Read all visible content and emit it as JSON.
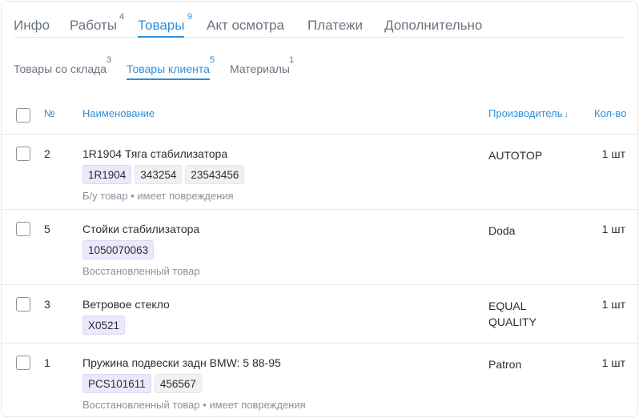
{
  "main_tabs": [
    {
      "label": "Инфо",
      "badge": ""
    },
    {
      "label": "Работы",
      "badge": "4"
    },
    {
      "label": "Товары",
      "badge": "9"
    },
    {
      "label": "Акт осмотра",
      "badge": ""
    },
    {
      "label": "Платежи",
      "badge": ""
    },
    {
      "label": "Дополнительно",
      "badge": ""
    }
  ],
  "sub_tabs": [
    {
      "label": "Товары со склада",
      "badge": "3"
    },
    {
      "label": "Товары клиента",
      "badge": "5"
    },
    {
      "label": "Материалы",
      "badge": "1"
    }
  ],
  "table": {
    "headers": {
      "num": "№",
      "name": "Наименование",
      "maker": "Производитель",
      "maker_sort_icon": "arrow-down-icon",
      "qty": "Кол-во"
    },
    "rows": [
      {
        "num": "2",
        "name": "1R1904 Тяга стабилизатора",
        "codes": [
          "1R1904",
          "343254",
          "23543456"
        ],
        "note": "Б/у товар • имеет повреждения",
        "maker": "AUTOTOP",
        "qty": "1 шт"
      },
      {
        "num": "5",
        "name": "Стойки стабилизатора",
        "codes": [
          "1050070063"
        ],
        "note": "Восстановленный товар",
        "maker": "Doda",
        "qty": "1 шт"
      },
      {
        "num": "3",
        "name": "Ветровое стекло",
        "codes": [
          "X0521"
        ],
        "note": "",
        "maker": "EQUAL QUALITY",
        "qty": "1 шт"
      },
      {
        "num": "1",
        "name": "Пружина подвески задн BMW: 5 88-95",
        "codes": [
          "PCS101611",
          "456567"
        ],
        "note": "Восстановленный товар • имеет повреждения",
        "maker": "Patron",
        "qty": "1 шт"
      }
    ]
  },
  "colors": {
    "accent": "#2f8fd8",
    "primary_chip_bg": "#ece8fb",
    "chip_bg": "#f0f1f3",
    "muted_text": "#8a929c"
  }
}
